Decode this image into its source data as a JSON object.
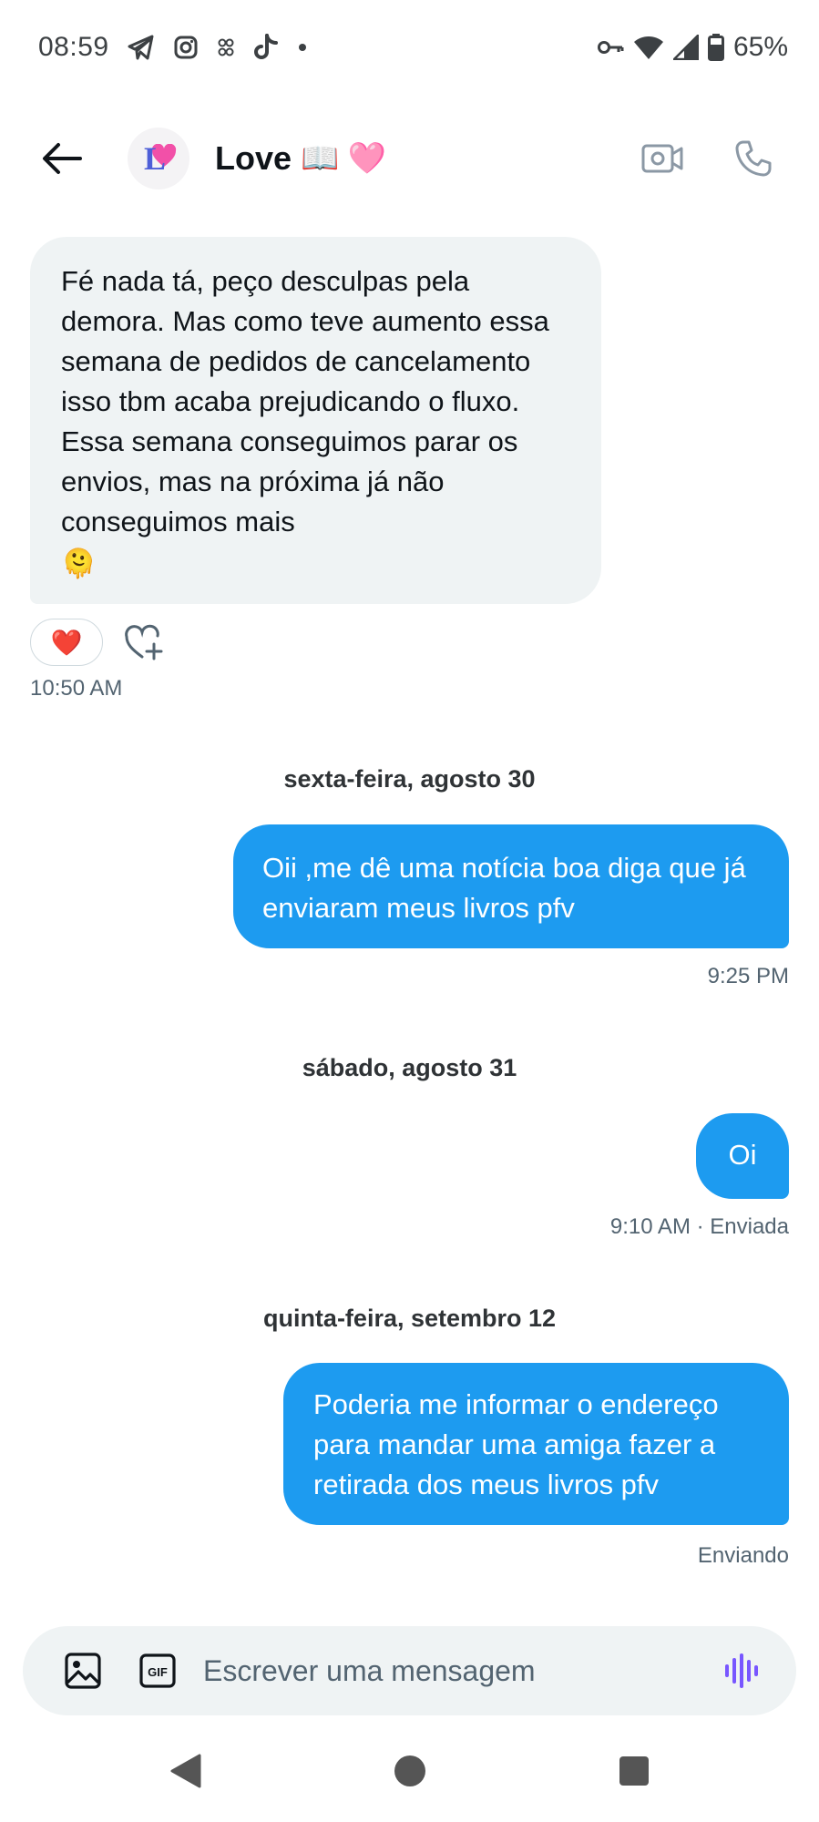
{
  "status_bar": {
    "time": "08:59",
    "battery": "65%",
    "left_icons": [
      "telegram-icon",
      "instagram-icon",
      "app-icon",
      "tiktok-icon",
      "dot-icon"
    ],
    "right_icons": [
      "vpn-key-icon",
      "wifi-icon",
      "signal-icon",
      "battery-icon"
    ]
  },
  "header": {
    "contact_name": "Love",
    "name_emojis": "📖 🩷",
    "avatar_letter": "L",
    "actions": [
      "video-call-icon",
      "phone-call-icon"
    ]
  },
  "messages": [
    {
      "direction": "incoming",
      "text": "Fé nada tá, peço desculpas pela demora. Mas como teve aumento essa semana de pedidos de cancelamento isso tbm acaba prejudicando o fluxo. Essa semana conseguimos parar os envios, mas na próxima já não conseguimos mais",
      "emoji": "🫠",
      "reaction": "❤️",
      "time": "10:50 AM"
    },
    {
      "date_divider": "sexta-feira, agosto 30",
      "direction": "outgoing",
      "text": "Oii ,me dê uma notícia boa diga que já enviaram meus livros pfv",
      "time": "9:25 PM"
    },
    {
      "date_divider": "sábado, agosto 31",
      "direction": "outgoing",
      "text": "Oi",
      "time": "9:10 AM · Enviada"
    },
    {
      "date_divider": "quinta-feira, setembro 12",
      "direction": "outgoing",
      "text": "Poderia me informar o endereço para mandar uma amiga fazer a retirada dos meus livros pfv",
      "time": "Enviando"
    }
  ],
  "composer": {
    "placeholder": "Escrever uma mensagem",
    "icons": [
      "image-icon",
      "gif-icon",
      "voice-message-icon"
    ],
    "accent_color": "#7856ff"
  },
  "colors": {
    "outgoing_bubble": "#1d9bf0",
    "incoming_bubble": "#eff3f4",
    "secondary_text": "#536471"
  },
  "nav_bar": [
    "back-nav",
    "home-nav",
    "recents-nav"
  ]
}
